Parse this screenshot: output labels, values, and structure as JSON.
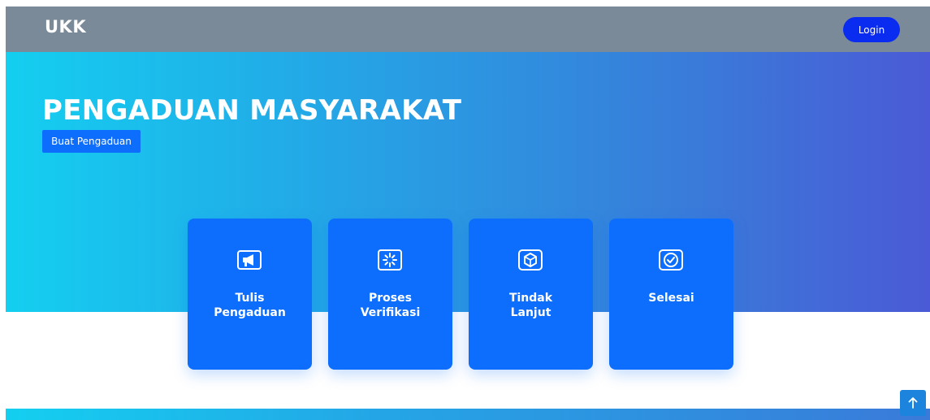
{
  "navbar": {
    "brand": "UKK",
    "login_label": "Login"
  },
  "hero": {
    "title": "PENGADUAN MASYARAKAT",
    "button_label": "Buat Pengaduan"
  },
  "cards": [
    {
      "line1": "Tulis",
      "line2": "Pengaduan",
      "icon": "megaphone-icon"
    },
    {
      "line1": "Proses",
      "line2": "Verifikasi",
      "icon": "loader-icon"
    },
    {
      "line1": "Tindak",
      "line2": "Lanjut",
      "icon": "cube-icon"
    },
    {
      "line1": "Selesai",
      "line2": "",
      "icon": "check-circle-icon"
    }
  ],
  "back_to_top": {
    "icon": "arrow-up-icon"
  },
  "colors": {
    "navbar": "#7b8a99",
    "primary": "#0d6efd",
    "login": "#0a2cf0",
    "hero_start": "#14cff0",
    "hero_end": "#4b5ad6"
  }
}
